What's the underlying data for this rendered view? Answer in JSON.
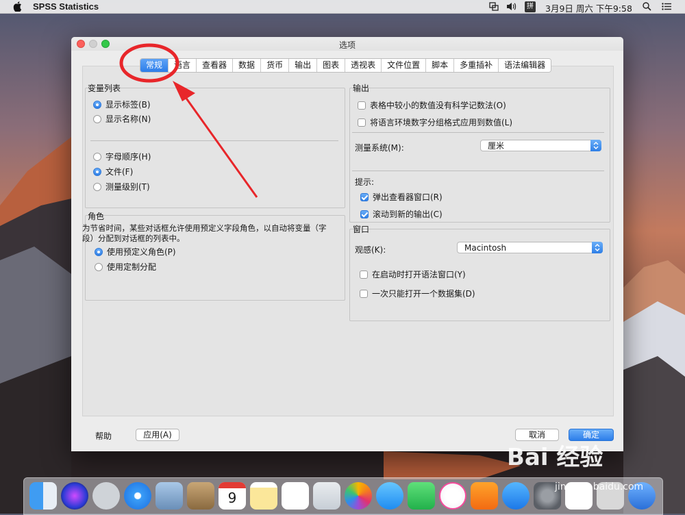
{
  "menubar": {
    "app_name": "SPSS Statistics",
    "ime_label": "拼",
    "clock": "3月9日 周六 下午9:58"
  },
  "window": {
    "title": "选项",
    "tabs": [
      {
        "label": "常规",
        "active": true
      },
      {
        "label": "语言"
      },
      {
        "label": "查看器"
      },
      {
        "label": "数据"
      },
      {
        "label": "货币"
      },
      {
        "label": "输出"
      },
      {
        "label": "图表"
      },
      {
        "label": "透视表"
      },
      {
        "label": "文件位置"
      },
      {
        "label": "脚本"
      },
      {
        "label": "多重插补"
      },
      {
        "label": "语法编辑器"
      }
    ],
    "variable_list": {
      "title": "变量列表",
      "display_label": "显示标签(B)",
      "display_name": "显示名称(N)",
      "alphabetical": "字母顺序(H)",
      "file": "文件(F)",
      "measure_level": "测量级别(T)"
    },
    "roles": {
      "title": "角色",
      "description_line1": "为节省时间，某些对话框允许使用预定义字段角色，以自动将变量（字",
      "description_line2": "段）分配到对话框的列表中。",
      "use_predefined": "使用预定义角色(P)",
      "use_custom": "使用定制分配"
    },
    "output": {
      "title": "输出",
      "no_sci_notation": "表格中较小的数值没有科学记数法(O)",
      "apply_locale": "将语言环境数字分组格式应用到数值(L)",
      "measurement_label": "测量系统(M):",
      "measurement_value": "厘米",
      "hints_label": "提示:",
      "popup_viewer": "弹出查看器窗口(R)",
      "scroll_new_output": "滚动到新的输出(C)"
    },
    "window_group": {
      "title": "窗口",
      "look_label": "观感(K):",
      "look_value": "Macintosh",
      "open_syntax": "在启动时打开语法窗口(Y)",
      "single_dataset": "一次只能打开一个数据集(D)"
    },
    "buttons": {
      "help": "帮助",
      "apply": "应用(A)",
      "cancel": "取消",
      "ok": "确定"
    }
  },
  "dock": {
    "calendar_day": "9"
  },
  "watermark": {
    "brand": "Bai 经验",
    "url": "jingyan.baidu.com"
  },
  "colors": {
    "accent": "#2c7de9",
    "annotation": "#e8262a"
  }
}
